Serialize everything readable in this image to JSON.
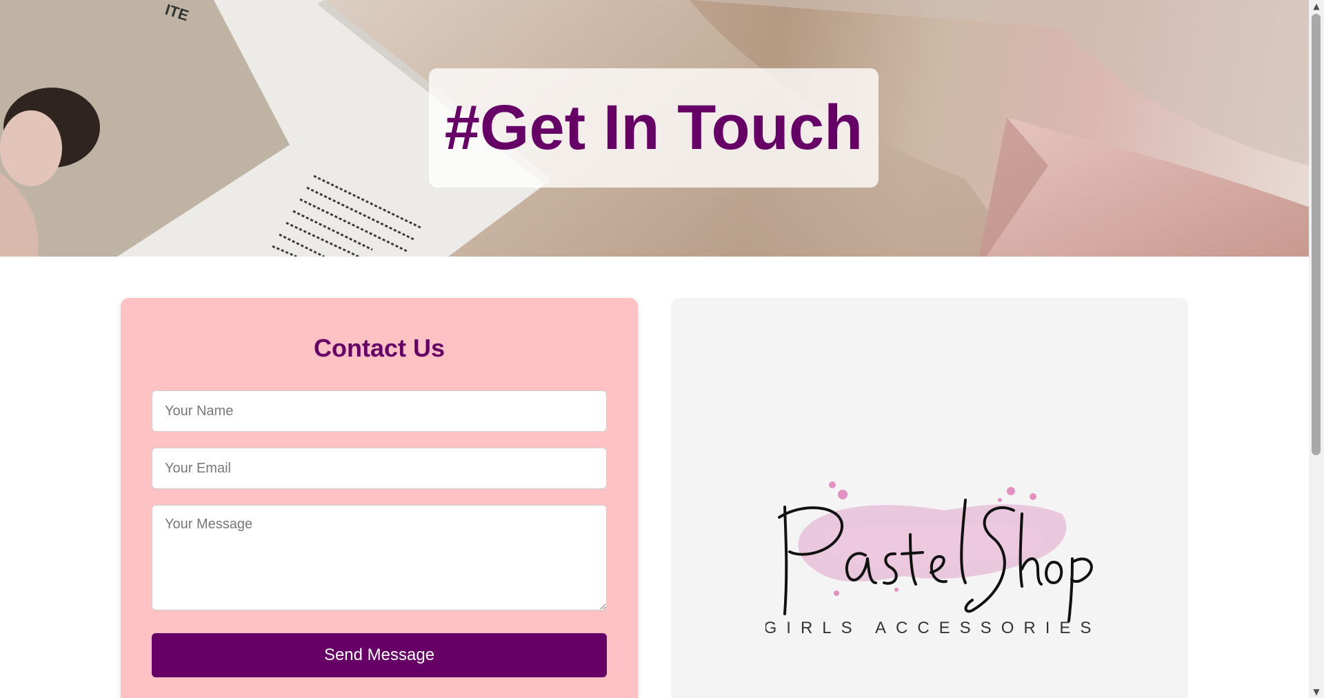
{
  "hero": {
    "title": "#Get In Touch"
  },
  "contact": {
    "title": "Contact Us",
    "name_placeholder": "Your Name",
    "email_placeholder": "Your Email",
    "message_placeholder": "Your Message",
    "submit_label": "Send Message"
  },
  "logo": {
    "brand_name": "Pastel Shop",
    "tagline": "GIRLS ACCESSORIES"
  },
  "colors": {
    "accent": "#660066",
    "card_background": "#ffc2c4",
    "panel_background": "#f4f4f4"
  },
  "icons": {
    "scroll_up": "triangle-up-icon",
    "scroll_down": "triangle-down-icon"
  }
}
